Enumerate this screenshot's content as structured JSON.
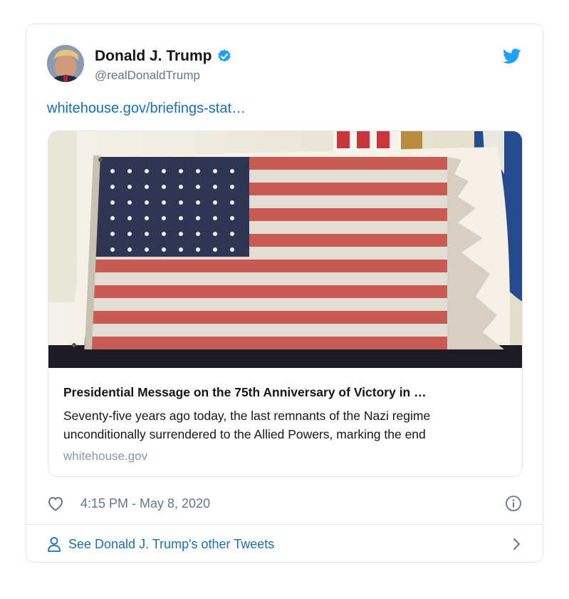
{
  "tweet": {
    "author": {
      "display_name": "Donald J. Trump",
      "handle": "@realDonaldTrump",
      "verified": true
    },
    "text_link": "whitehouse.gov/briefings-stat…",
    "link_card": {
      "title": "Presidential Message on the 75th Anniversary of Victory in …",
      "description": "Seventy-five years ago today, the last remnants of the Nazi regime unconditionally surrendered to the Allied Powers, marking the end",
      "domain": "whitehouse.gov"
    },
    "timestamp": "4:15 PM - May 8, 2020",
    "footer_link": "See Donald J. Trump's other Tweets"
  },
  "icons": {
    "verified": "verified-badge-icon",
    "brand": "twitter-bird-icon",
    "like": "heart-icon",
    "info": "info-icon",
    "profile": "person-icon",
    "more": "chevron-right-icon"
  },
  "colors": {
    "link": "#1b6fb0",
    "twitter_blue": "#1da1f2",
    "muted": "#657786",
    "border": "#e1e8ed"
  }
}
